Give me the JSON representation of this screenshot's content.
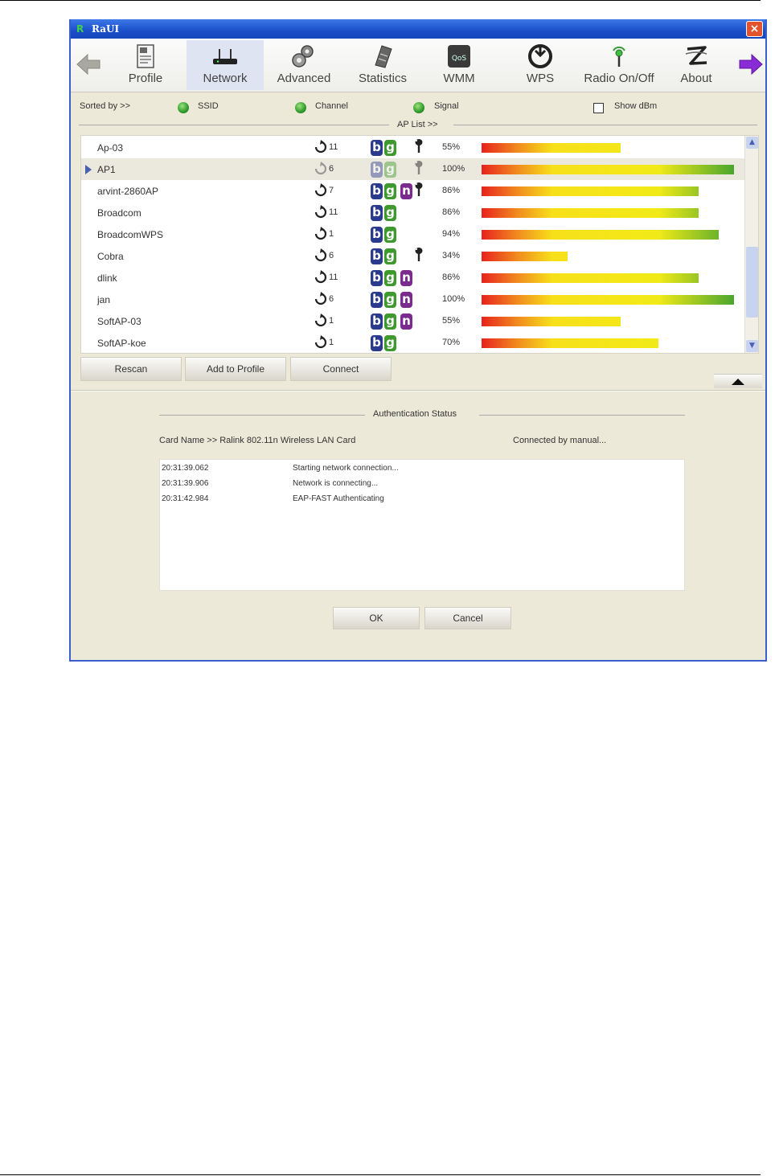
{
  "window": {
    "title": "RaUI",
    "close_glyph": "×"
  },
  "toolbar": {
    "items": [
      {
        "label": "Profile",
        "icon": "profile-icon"
      },
      {
        "label": "Network",
        "icon": "network-icon",
        "active": true
      },
      {
        "label": "Advanced",
        "icon": "advanced-icon"
      },
      {
        "label": "Statistics",
        "icon": "statistics-icon"
      },
      {
        "label": "WMM",
        "icon": "wmm-icon"
      },
      {
        "label": "WPS",
        "icon": "wps-icon"
      },
      {
        "label": "Radio On/Off",
        "icon": "radio-icon"
      },
      {
        "label": "About",
        "icon": "about-icon"
      }
    ],
    "wmm_icon_text": "QoS"
  },
  "sort": {
    "label": "Sorted by >>",
    "options": [
      "SSID",
      "Channel",
      "Signal"
    ],
    "show_dbm": "Show dBm"
  },
  "ap_list": {
    "caption": "AP List >>",
    "rows": [
      {
        "ssid": "Ap-03",
        "channel": "11",
        "modes": [
          "b",
          "g"
        ],
        "secured": true,
        "signal": "55%",
        "signal_value": 55
      },
      {
        "ssid": "AP1",
        "channel": "6",
        "modes": [
          "b",
          "g"
        ],
        "secured": true,
        "signal": "100%",
        "signal_value": 100,
        "selected": true
      },
      {
        "ssid": "arvint-2860AP",
        "channel": "7",
        "modes": [
          "b",
          "g",
          "n"
        ],
        "secured": true,
        "signal": "86%",
        "signal_value": 86
      },
      {
        "ssid": "Broadcom",
        "channel": "11",
        "modes": [
          "b",
          "g"
        ],
        "secured": false,
        "signal": "86%",
        "signal_value": 86
      },
      {
        "ssid": "BroadcomWPS",
        "channel": "1",
        "modes": [
          "b",
          "g"
        ],
        "secured": false,
        "signal": "94%",
        "signal_value": 94
      },
      {
        "ssid": "Cobra",
        "channel": "6",
        "modes": [
          "b",
          "g"
        ],
        "secured": true,
        "signal": "34%",
        "signal_value": 34
      },
      {
        "ssid": "dlink",
        "channel": "11",
        "modes": [
          "b",
          "g",
          "n"
        ],
        "secured": false,
        "signal": "86%",
        "signal_value": 86
      },
      {
        "ssid": "jan",
        "channel": "6",
        "modes": [
          "b",
          "g",
          "n"
        ],
        "secured": false,
        "signal": "100%",
        "signal_value": 100
      },
      {
        "ssid": "SoftAP-03",
        "channel": "1",
        "modes": [
          "b",
          "g",
          "n"
        ],
        "secured": false,
        "signal": "55%",
        "signal_value": 55
      },
      {
        "ssid": "SoftAP-koe",
        "channel": "1",
        "modes": [
          "b",
          "g"
        ],
        "secured": false,
        "signal": "70%",
        "signal_value": 70
      }
    ]
  },
  "buttons": {
    "rescan": "Rescan",
    "add_to_profile": "Add to Profile",
    "connect": "Connect",
    "ok": "OK",
    "cancel": "Cancel"
  },
  "auth": {
    "caption": "Authentication Status",
    "card_name": "Card Name >> Ralink 802.11n Wireless LAN Card",
    "connected_by": "Connected by manual...",
    "log": [
      {
        "time": "20:31:39.062",
        "message": "Starting network connection..."
      },
      {
        "time": "20:31:39.906",
        "message": "Network is connecting..."
      },
      {
        "time": "20:31:42.984",
        "message": "EAP-FAST Authenticating"
      }
    ]
  },
  "colors": {
    "title_bar": "#1a4fc9",
    "window_bg": "#ece9d8",
    "badge_b": "#2a3a8c",
    "badge_g": "#3e9a2e",
    "badge_n": "#7b2a8e",
    "nav_forward": "#8a2bd8"
  }
}
